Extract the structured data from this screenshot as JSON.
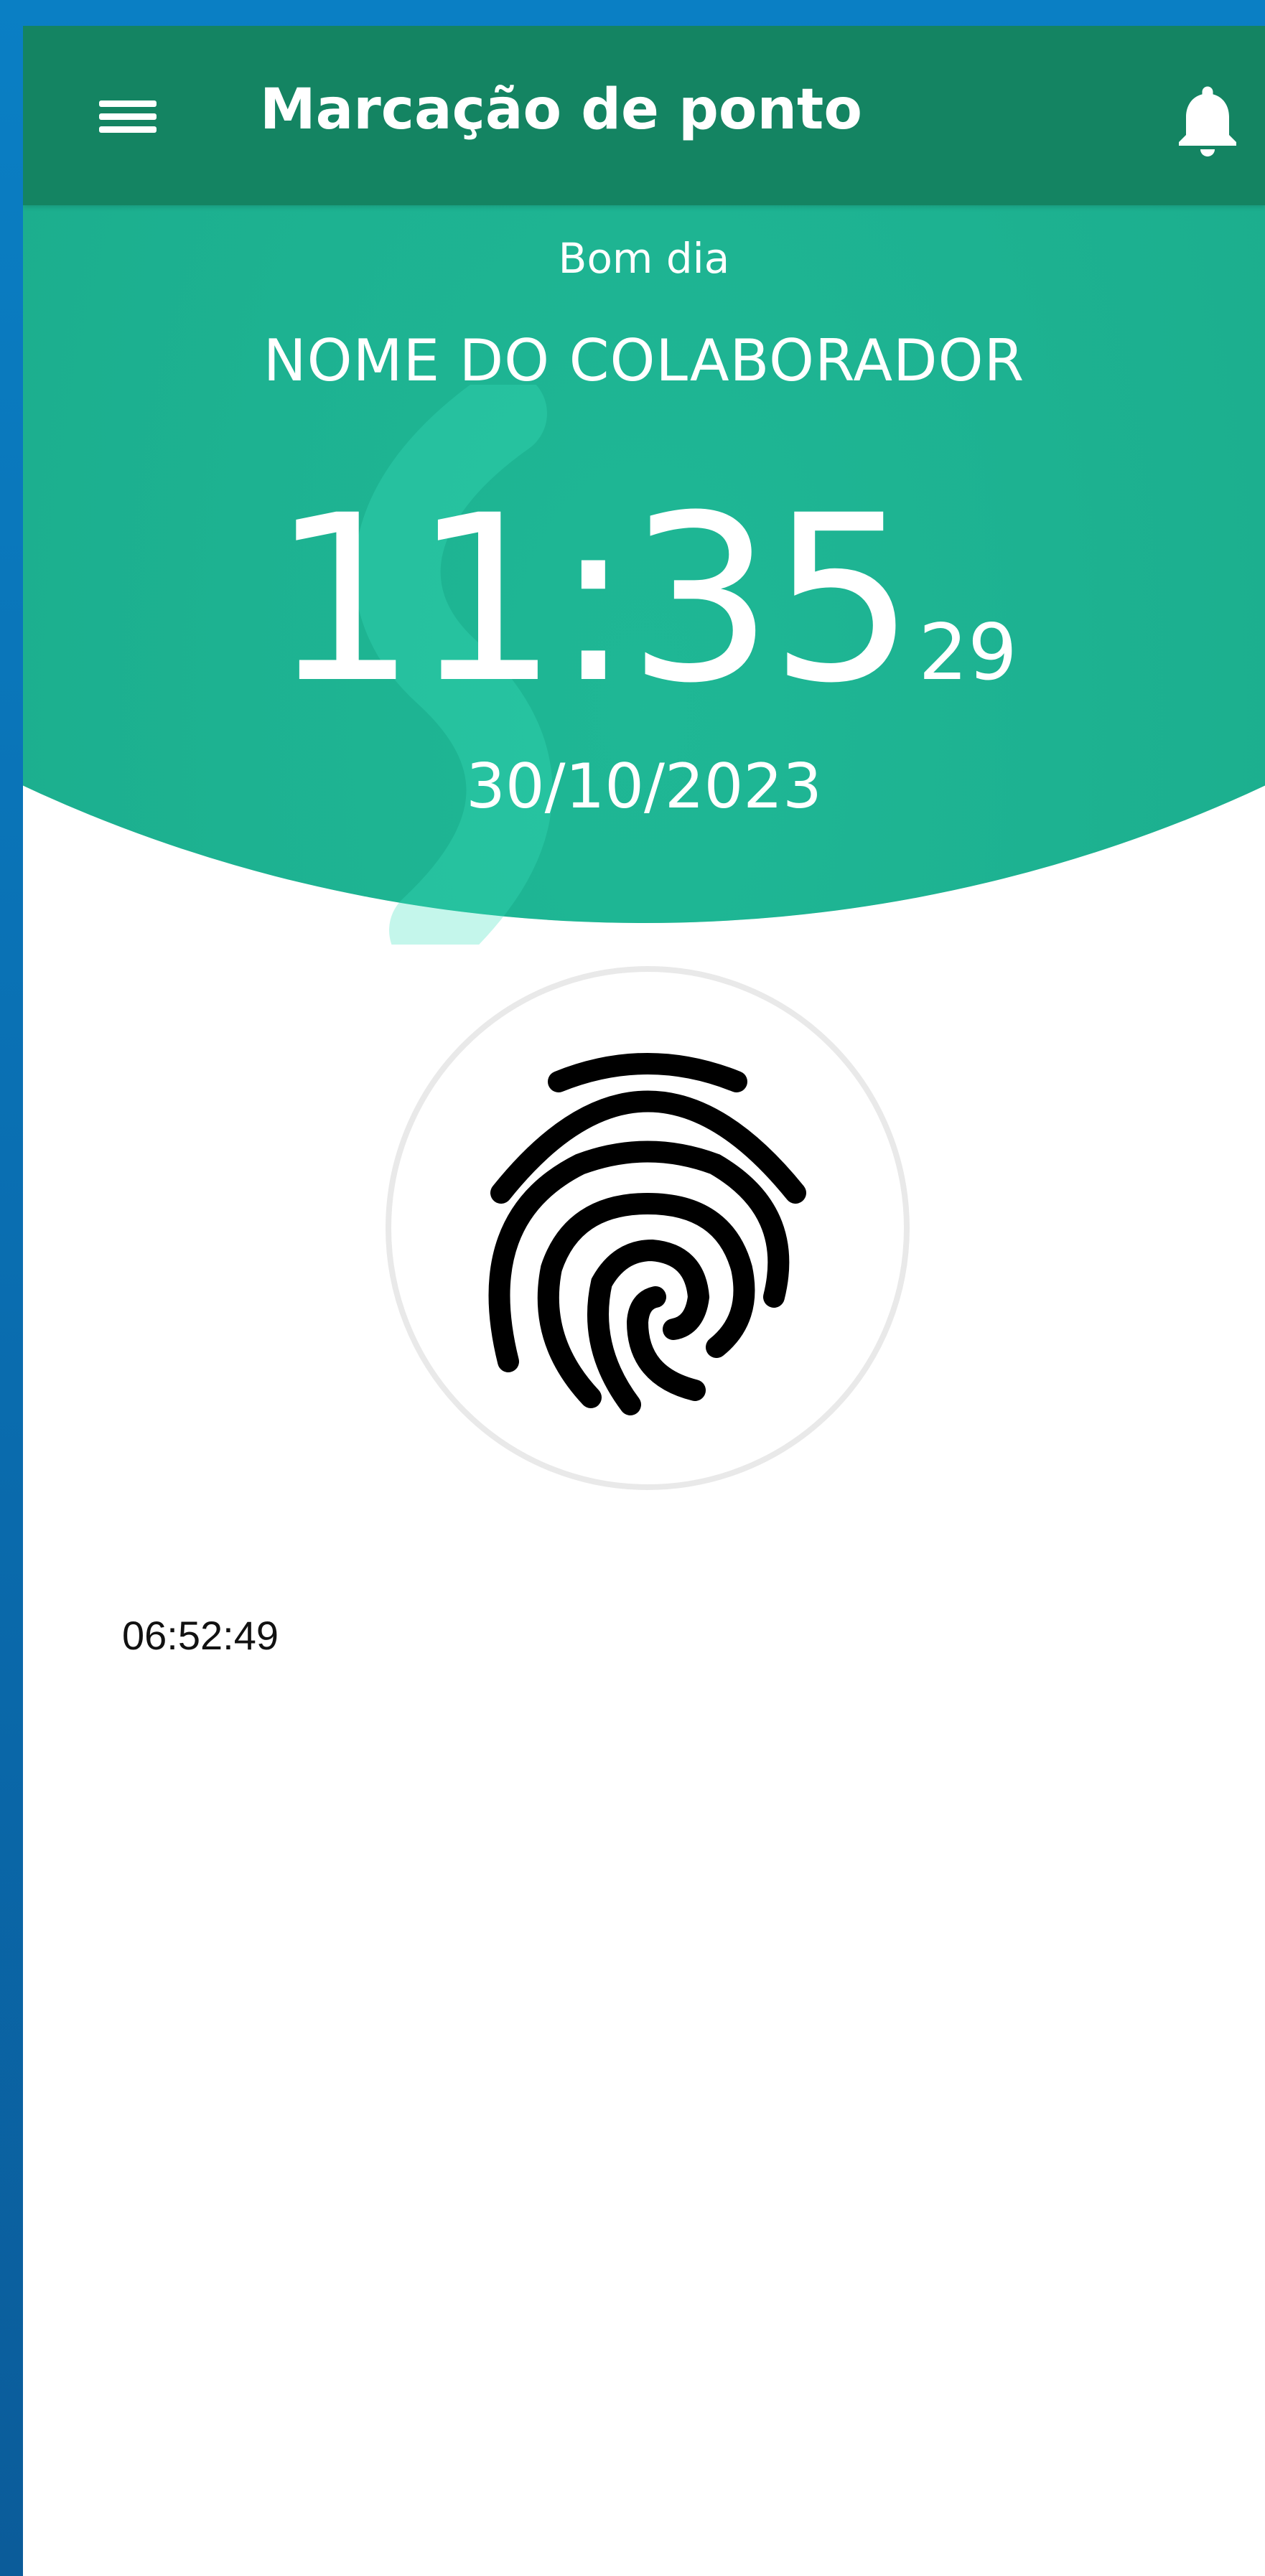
{
  "app_bar": {
    "title": "Marcação de ponto",
    "menu_icon": "menu-icon",
    "notification_icon": "bell-icon"
  },
  "header": {
    "greeting": "Bom dia",
    "employee_name": "NOME DO COLABORADOR",
    "clock": {
      "hours_minutes": "11:35",
      "seconds": "29"
    },
    "date": "30/10/2023"
  },
  "punch_button": {
    "icon": "fingerprint-icon"
  },
  "records": [
    {
      "time": "06:52:49"
    }
  ],
  "colors": {
    "app_bar": "#148462",
    "hero": "#1aa98a",
    "background": "#ffffff",
    "outer_frame": "#0a7fc4"
  }
}
